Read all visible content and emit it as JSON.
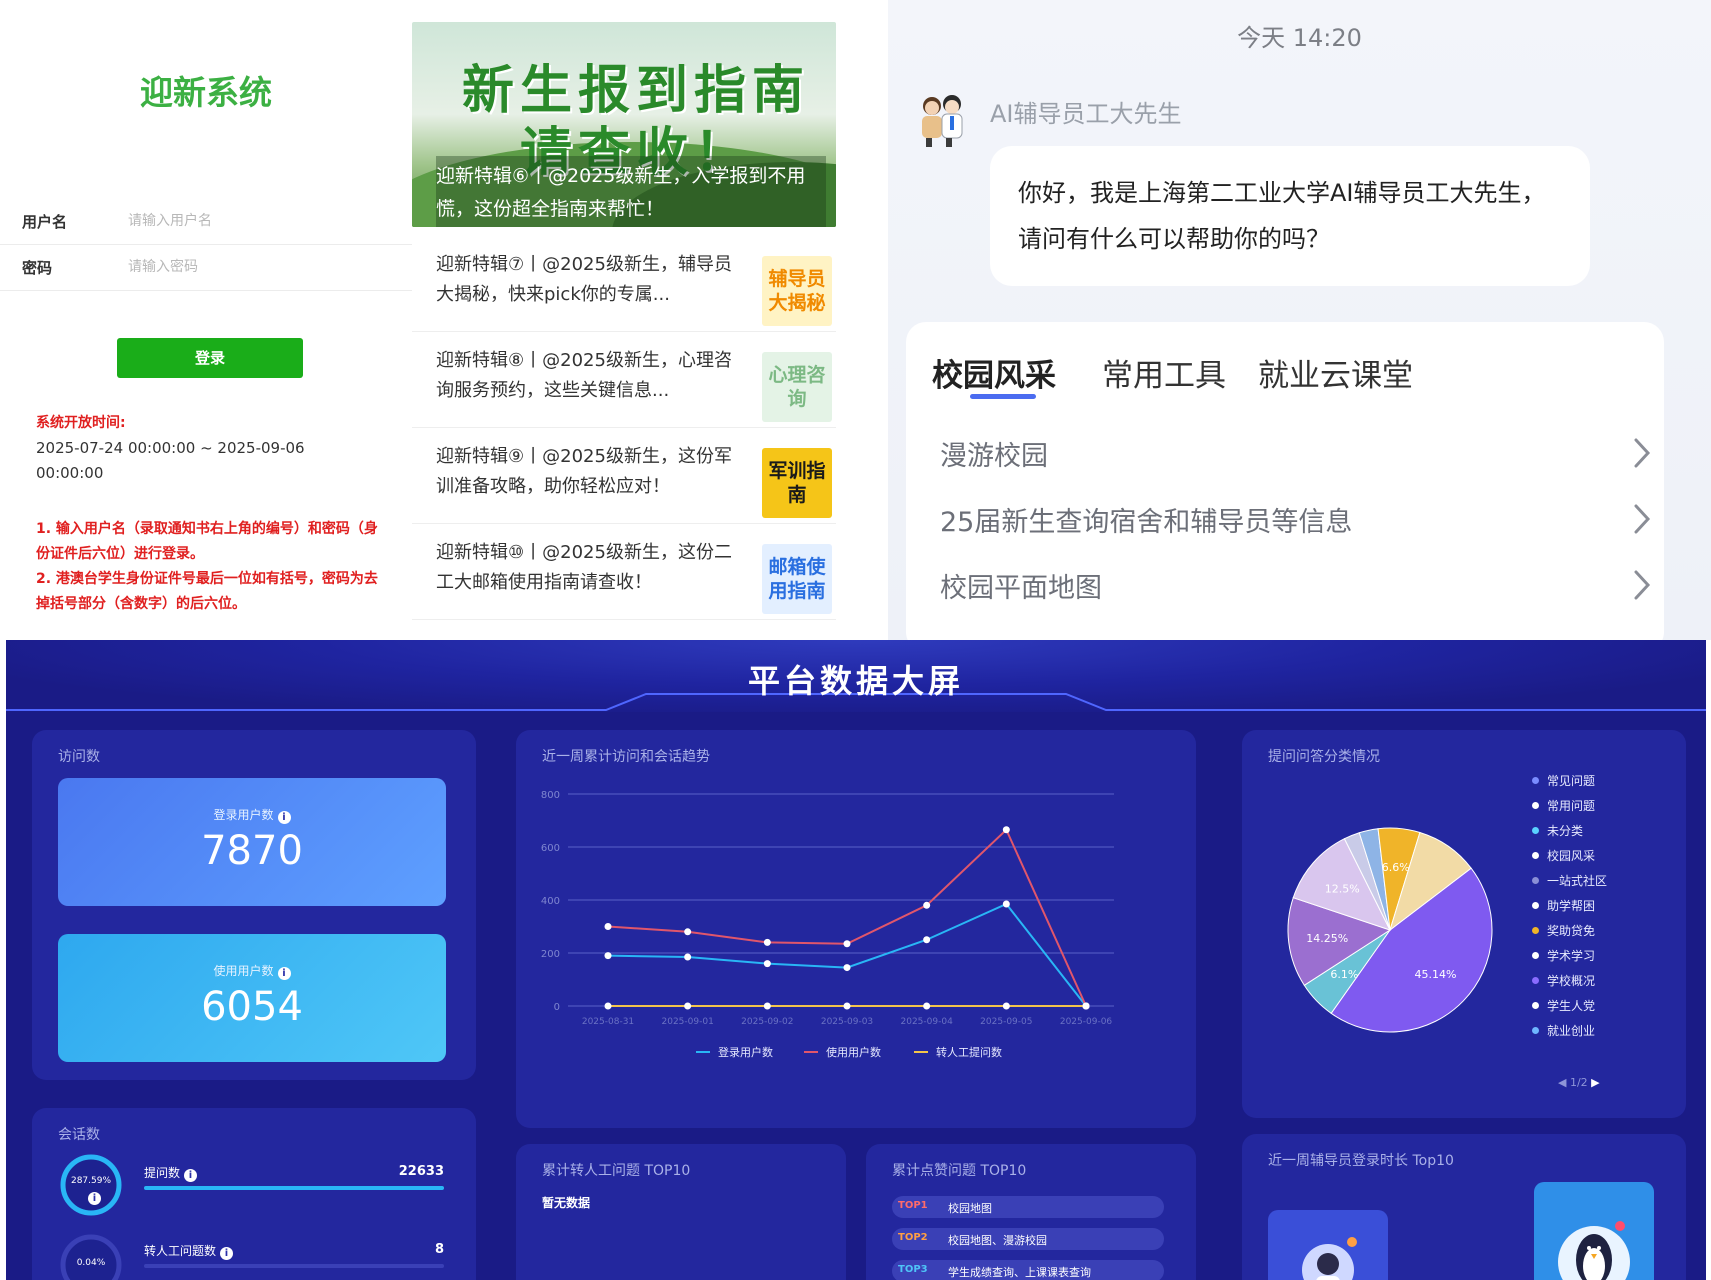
{
  "login": {
    "title": "迎新系统",
    "username_label": "用户名",
    "username_placeholder": "请输入用户名",
    "password_label": "密码",
    "password_placeholder": "请输入密码",
    "login_button": "登录",
    "open_time_label": "系统开放时间:",
    "open_time_value": "2025-07-24 00:00:00 ~ 2025-09-06 00:00:00",
    "note_1": "1. 输入用户名（录取通知书右上角的编号）和密码（身份证件后六位）进行登录。",
    "note_2": "2. 港澳台学生身份证件号最后一位如有括号，密码为去掉括号部分（含数字）的后六位。"
  },
  "news": {
    "banner_line1": "新生报到指南",
    "banner_line2": "请查收！",
    "banner_caption": "迎新特辑⑥丨@2025级新生，入学报到不用慌，这份超全指南来帮忙！",
    "items": [
      {
        "text": "迎新特辑⑦丨@2025级新生，辅导员大揭秘，快来pick你的专属...",
        "thumb": "辅导员大揭秘",
        "thumb_bg": "#fff3c4",
        "thumb_color": "#f08a00"
      },
      {
        "text": "迎新特辑⑧丨@2025级新生，心理咨询服务预约，这些关键信息...",
        "thumb": "心理咨询",
        "thumb_bg": "#e4f3e6",
        "thumb_color": "#7cb984"
      },
      {
        "text": "迎新特辑⑨丨@2025级新生，这份军训准备攻略，助你轻松应对！",
        "thumb": "军训指南",
        "thumb_bg": "#f5c518",
        "thumb_color": "#1a1a1a"
      },
      {
        "text": "迎新特辑⑩丨@2025级新生，这份二工大邮箱使用指南请查收！",
        "thumb": "邮箱使用指南",
        "thumb_bg": "#e3efff",
        "thumb_color": "#2a6fe0"
      }
    ]
  },
  "chat": {
    "time": "今天 14:20",
    "sender": "AI辅导员工大先生",
    "message": "你好，我是上海第二工业大学AI辅导员工大先生，请问有什么可以帮助你的吗？",
    "tabs": [
      "校园风采",
      "常用工具",
      "就业云课堂"
    ],
    "links": [
      "漫游校园",
      "25届新生查询宿舍和辅导员等信息",
      "校园平面地图"
    ]
  },
  "dashboard": {
    "title": "平台数据大屏",
    "visits": {
      "title": "访问数",
      "login_users_label": "登录用户数",
      "login_users_value": "7870",
      "active_users_label": "使用用户数",
      "active_users_value": "6054"
    },
    "sessions": {
      "title": "会话数",
      "ring_value": "287.59%",
      "ring2_value": "0.04%",
      "row1_label": "提问数",
      "row1_value": "22633",
      "row2_label": "转人工问题数",
      "row2_value": "8"
    },
    "trend_title": "近一周累计访问和会话趋势",
    "pie_title": "提问问答分类情况",
    "pie_page": "1/2",
    "transfer_title": "累计转人工问题 TOP10",
    "transfer_empty": "暂无数据",
    "hot_title": "累计点赞问题 TOP10",
    "hot_items": [
      {
        "rank": "TOP1",
        "name": "校园地图"
      },
      {
        "rank": "TOP2",
        "name": "校园地图、漫游校园"
      },
      {
        "rank": "TOP3",
        "name": "学生成绩查询、上课课表查询"
      }
    ],
    "counselor_title": "近一周辅导员登录时长 Top10",
    "legend": [
      {
        "name": "常见问题",
        "color": "#7a8cff"
      },
      {
        "name": "常用问题",
        "color": "#ffffff"
      },
      {
        "name": "未分类",
        "color": "#5ad1ff"
      },
      {
        "name": "校园风采",
        "color": "#ffffff"
      },
      {
        "name": "一站式社区",
        "color": "#8a8fd6"
      },
      {
        "name": "助学帮困",
        "color": "#ffffff"
      },
      {
        "name": "奖助贷免",
        "color": "#f0b429"
      },
      {
        "name": "学术学习",
        "color": "#ffffff"
      },
      {
        "name": "学校概况",
        "color": "#8a6cff"
      },
      {
        "name": "学生人党",
        "color": "#ffffff"
      },
      {
        "name": "就业创业",
        "color": "#6fb6ff"
      }
    ]
  },
  "chart_data": [
    {
      "type": "line",
      "title": "近一周累计访问和会话趋势",
      "x": [
        "2025-08-31",
        "2025-09-01",
        "2025-09-02",
        "2025-09-03",
        "2025-09-04",
        "2025-09-05",
        "2025-09-06"
      ],
      "ylim": [
        0,
        800
      ],
      "yticks": [
        0,
        200,
        400,
        600,
        800
      ],
      "series": [
        {
          "name": "登录用户数",
          "color": "#29b6f6",
          "values": [
            190,
            185,
            160,
            145,
            250,
            385,
            0
          ]
        },
        {
          "name": "使用用户数",
          "color": "#e0566b",
          "values": [
            300,
            280,
            240,
            235,
            380,
            665,
            0
          ]
        },
        {
          "name": "转人工提问数",
          "color": "#f3c44b",
          "values": [
            0,
            0,
            0,
            0,
            0,
            0,
            0
          ]
        }
      ],
      "legend_position": "bottom"
    },
    {
      "type": "pie",
      "title": "提问问答分类情况",
      "slices": [
        {
          "label": "学校概况",
          "value": 45.14,
          "color": "#7f5af0",
          "text": "45.14%"
        },
        {
          "label": "就业创业",
          "value": 6.1,
          "color": "#69c2d6",
          "text": "6.1%"
        },
        {
          "label": "一站式社区",
          "value": 14.25,
          "color": "#9b6fd0",
          "text": "14.25%"
        },
        {
          "label": "校园风采",
          "value": 12.5,
          "color": "#d9c6ee",
          "text": "12.5%"
        },
        {
          "label": "常见问题",
          "value": 2.5,
          "color": "#c9cbe8",
          "text": ""
        },
        {
          "label": "未分类",
          "value": 3.0,
          "color": "#8eb4e6",
          "text": ""
        },
        {
          "label": "奖助贷免",
          "value": 6.6,
          "color": "#f0b429",
          "text": "6.6%"
        },
        {
          "label": "学术学习",
          "value": 9.91,
          "color": "#f2dba6",
          "text": ""
        }
      ]
    }
  ]
}
